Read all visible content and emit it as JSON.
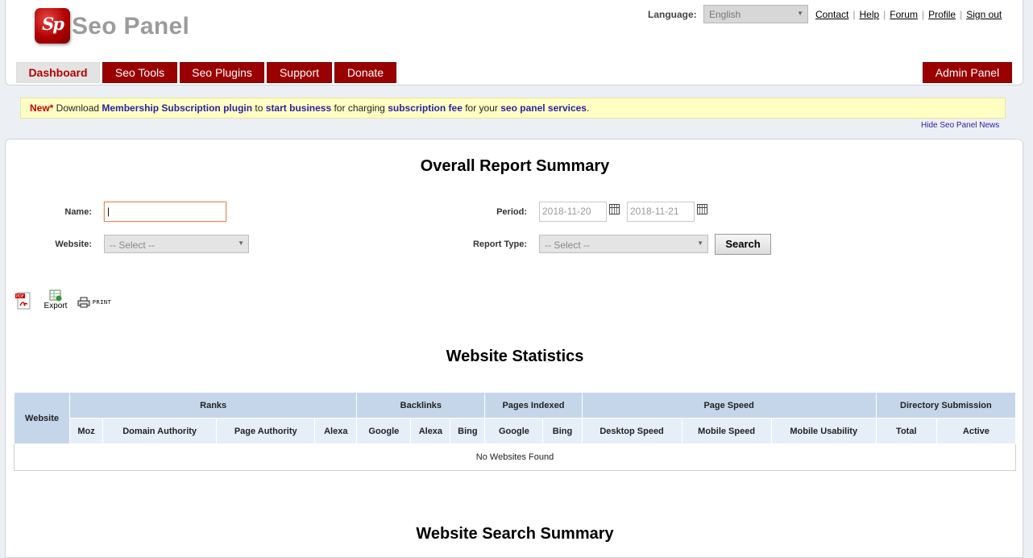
{
  "app": {
    "logo_glyph": "Sp",
    "logo_text": "Seo Panel"
  },
  "header": {
    "language_label": "Language:",
    "language_value": "English",
    "links": [
      "Contact",
      "Help",
      "Forum",
      "Profile",
      "Sign out"
    ],
    "tabs": [
      "Dashboard",
      "Seo Tools",
      "Seo Plugins",
      "Support",
      "Donate"
    ],
    "active_tab": "Dashboard",
    "admin_tab": "Admin Panel"
  },
  "news": {
    "new_label": "New*",
    "t1": " Download ",
    "b1": "Membership Subscription plugin",
    "t2": " to ",
    "b2": "start business",
    "t3": " for charging ",
    "b3": "subscription fee",
    "t4": " for your ",
    "b4": "seo panel services",
    "t5": ".",
    "hide_label": "Hide Seo Panel News"
  },
  "report": {
    "title": "Overall Report Summary",
    "name_label": "Name:",
    "name_value": "",
    "website_label": "Website:",
    "website_value": "-- Select --",
    "period_label": "Period:",
    "period_from": "2018-11-20",
    "period_to": "2018-11-21",
    "report_type_label": "Report Type:",
    "report_type_value": "-- Select --",
    "search_label": "Search"
  },
  "toolbar": {
    "pdf_icon": "pdf-icon",
    "export_label": "Export",
    "print_label": "PRINT"
  },
  "stats": {
    "title": "Website Statistics",
    "website_col": "Website",
    "groups": {
      "ranks": "Ranks",
      "backlinks": "Backlinks",
      "pages_indexed": "Pages Indexed",
      "page_speed": "Page Speed",
      "directory": "Directory Submission"
    },
    "sub": {
      "moz": "Moz",
      "da": "Domain Authority",
      "pa": "Page Authority",
      "alexa": "Alexa",
      "bl_google": "Google",
      "bl_alexa": "Alexa",
      "bl_bing": "Bing",
      "pi_google": "Google",
      "pi_bing": "Bing",
      "desktop": "Desktop Speed",
      "mobile": "Mobile Speed",
      "usability": "Mobile Usability",
      "total": "Total",
      "active": "Active"
    },
    "empty_message": "No Websites Found"
  },
  "search_summary": {
    "title": "Website Search Summary"
  },
  "colors": {
    "brand_red": "#9b0000",
    "table_header": "#c5d6ea",
    "news_bg": "#ffffc4",
    "link_blue": "#2a1ea0"
  }
}
